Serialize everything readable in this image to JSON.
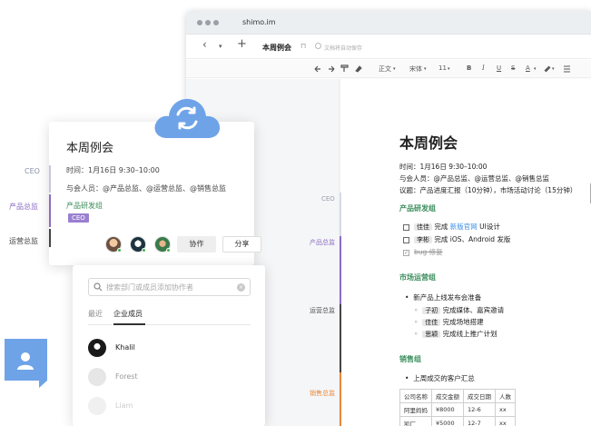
{
  "browser": {
    "url": "shimo.im"
  },
  "docbar": {
    "back_icon": "‹",
    "menu_icon": "▾",
    "add_icon": "+",
    "title": "本周例会",
    "bookmark_icon": "⊓",
    "saved_text": "文档将自动保存"
  },
  "toolbar": {
    "style": "正文",
    "font": "宋体",
    "size": "11",
    "bold": "B",
    "italic": "I",
    "underline": "U",
    "strike": "S",
    "color": "A"
  },
  "doc": {
    "title": "本周例会",
    "time": "时间：1月16日 9:30–10:00",
    "attendees": "与会人员：@产品总监、@运营总监、@销售总监",
    "agenda": "议题：产品进度汇报（10分钟），市场活动讨论（15分钟）",
    "section1": "产品研发组",
    "task1": {
      "who": "佳佳",
      "pre": "完成",
      "link": "新版官网",
      "post": "UI设计"
    },
    "task2": {
      "who": "李彬",
      "text": "完成 iOS、Android 发版"
    },
    "task3": {
      "text": "bug 修复"
    },
    "section2": "市场运营组",
    "market_head": "新产品上线发布会准备",
    "market_items": [
      {
        "who": "子初",
        "text": "完成媒体、嘉宾邀请"
      },
      {
        "who": "佳佳",
        "text": "完成场地搭建"
      },
      {
        "who": "思颖",
        "text": "完成线上推广计划"
      }
    ],
    "section3": "销售组",
    "sales_head": "上周成交的客户汇总",
    "table": [
      [
        "公司名称",
        "成交金额",
        "成交日期",
        "人数"
      ],
      [
        "阿里妈妈",
        "¥8000",
        "12-6",
        "xx"
      ],
      [
        "凯厂",
        "¥5000",
        "12-7",
        "xx"
      ]
    ]
  },
  "side_labels": {
    "ceo": "CEO",
    "product": "产品总监",
    "ops": "运营总监",
    "sales": "销售总监"
  },
  "outer_labels": {
    "ceo": "CEO",
    "product": "产品总监",
    "ops": "运营总监"
  },
  "card": {
    "title": "本周例会",
    "time": "时间：1月16日 9:30–10:00",
    "attendees": "与会人员：@产品总监、@运营总监、@销售总监",
    "group": "产品研发组",
    "badge": "CEO",
    "collab_btn": "协作",
    "share_btn": "分享"
  },
  "dropdown": {
    "search_placeholder": "搜索部门或成员添加协作者",
    "tab_recent": "最近",
    "tab_members": "企业成员",
    "members": [
      "Khalil",
      "Forest",
      "Liam"
    ]
  },
  "colors": {
    "accent_purple": "#8c6cc3",
    "green": "#3a8d5c",
    "orange": "#e8873a",
    "cloud": "#6fa3e8"
  }
}
